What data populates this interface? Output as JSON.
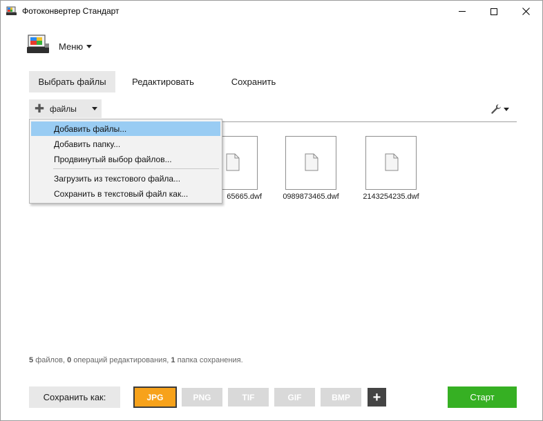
{
  "window": {
    "title": "Фотоконвертер Стандарт"
  },
  "menu": {
    "label": "Меню"
  },
  "tabs": [
    {
      "label": "Выбрать файлы",
      "active": true
    },
    {
      "label": "Редактировать",
      "active": false
    },
    {
      "label": "Сохранить",
      "active": false
    }
  ],
  "files_button": {
    "label": "файлы"
  },
  "dropdown": {
    "items": [
      {
        "label": "Добавить файлы...",
        "highlighted": true
      },
      {
        "label": "Добавить папку..."
      },
      {
        "label": "Продвинутый выбор файлов..."
      },
      {
        "label": "Загрузить из текстового файла..."
      },
      {
        "label": "Сохранить в текстовый файл как..."
      }
    ]
  },
  "files": [
    {
      "name": "2343465665.dwf",
      "visible_name": "65665.dwf",
      "icon": "document-icon"
    },
    {
      "name": "0989873465.dwf",
      "icon": "document-icon"
    },
    {
      "name": "2143254235.dwf",
      "icon": "document-icon"
    }
  ],
  "status": {
    "files_count": "5",
    "files_label": "файлов,",
    "edits_count": "0",
    "edits_label": "операций редактирования,",
    "folders_count": "1",
    "folders_label": "папка сохранения."
  },
  "bottom": {
    "save_as_label": "Сохранить как:",
    "formats": [
      {
        "label": "JPG",
        "selected": true
      },
      {
        "label": "PNG",
        "selected": false
      },
      {
        "label": "TIF",
        "selected": false
      },
      {
        "label": "GIF",
        "selected": false
      },
      {
        "label": "BMP",
        "selected": false
      }
    ],
    "add_format_label": "+",
    "start_label": "Старт"
  },
  "colors": {
    "accent_green": "#36b023",
    "selected_format": "#f7a21b",
    "menu_highlight": "#99ccf3",
    "inactive_format": "#d9d9d9"
  }
}
